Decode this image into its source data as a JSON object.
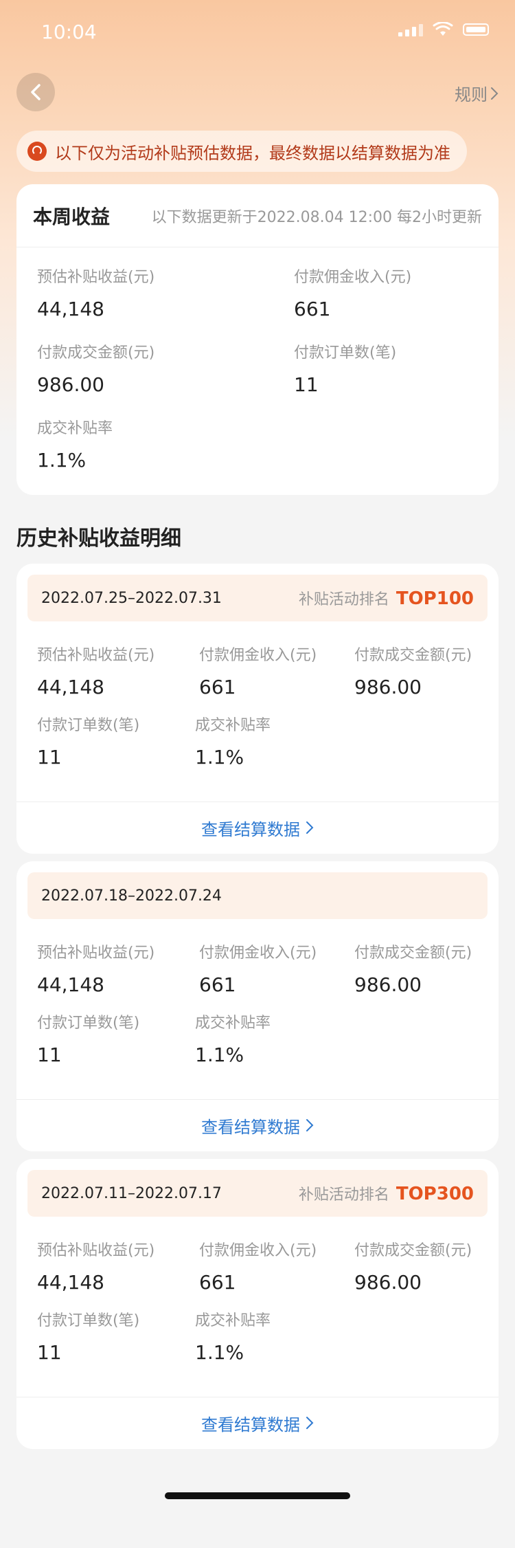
{
  "status_bar": {
    "time": "10:04"
  },
  "nav": {
    "rules_label": "规则"
  },
  "notice": {
    "text": "以下仅为活动补贴预估数据，最终数据以结算数据为准"
  },
  "week": {
    "title": "本周收益",
    "update_note": "以下数据更新于2022.08.04 12:00 每2小时更新",
    "metrics": [
      {
        "label": "预估补贴收益(元)",
        "value": "44,148"
      },
      {
        "label": "付款佣金收入(元)",
        "value": "661"
      },
      {
        "label": "付款成交金额(元)",
        "value": "986.00"
      },
      {
        "label": "付款订单数(笔)",
        "value": "11"
      },
      {
        "label": "成交补贴率",
        "value": "1.1%"
      }
    ]
  },
  "history": {
    "title": "历史补贴收益明细",
    "settle_label": "查看结算数据",
    "periods": [
      {
        "range": "2022.07.25–2022.07.31",
        "rank_label": "补贴活动排名",
        "rank_value": "TOP100",
        "metrics": [
          {
            "label": "预估补贴收益(元)",
            "value": "44,148"
          },
          {
            "label": "付款佣金收入(元)",
            "value": "661"
          },
          {
            "label": "付款成交金额(元)",
            "value": "986.00"
          },
          {
            "label": "付款订单数(笔)",
            "value": "11"
          },
          {
            "label": "成交补贴率",
            "value": "1.1%"
          }
        ]
      },
      {
        "range": "2022.07.18–2022.07.24",
        "rank_label": "",
        "rank_value": "",
        "metrics": [
          {
            "label": "预估补贴收益(元)",
            "value": "44,148"
          },
          {
            "label": "付款佣金收入(元)",
            "value": "661"
          },
          {
            "label": "付款成交金额(元)",
            "value": "986.00"
          },
          {
            "label": "付款订单数(笔)",
            "value": "11"
          },
          {
            "label": "成交补贴率",
            "value": "1.1%"
          }
        ]
      },
      {
        "range": "2022.07.11–2022.07.17",
        "rank_label": "补贴活动排名",
        "rank_value": "TOP300",
        "metrics": [
          {
            "label": "预估补贴收益(元)",
            "value": "44,148"
          },
          {
            "label": "付款佣金收入(元)",
            "value": "661"
          },
          {
            "label": "付款成交金额(元)",
            "value": "986.00"
          },
          {
            "label": "付款订单数(笔)",
            "value": "11"
          },
          {
            "label": "成交补贴率",
            "value": "1.1%"
          }
        ]
      }
    ]
  }
}
